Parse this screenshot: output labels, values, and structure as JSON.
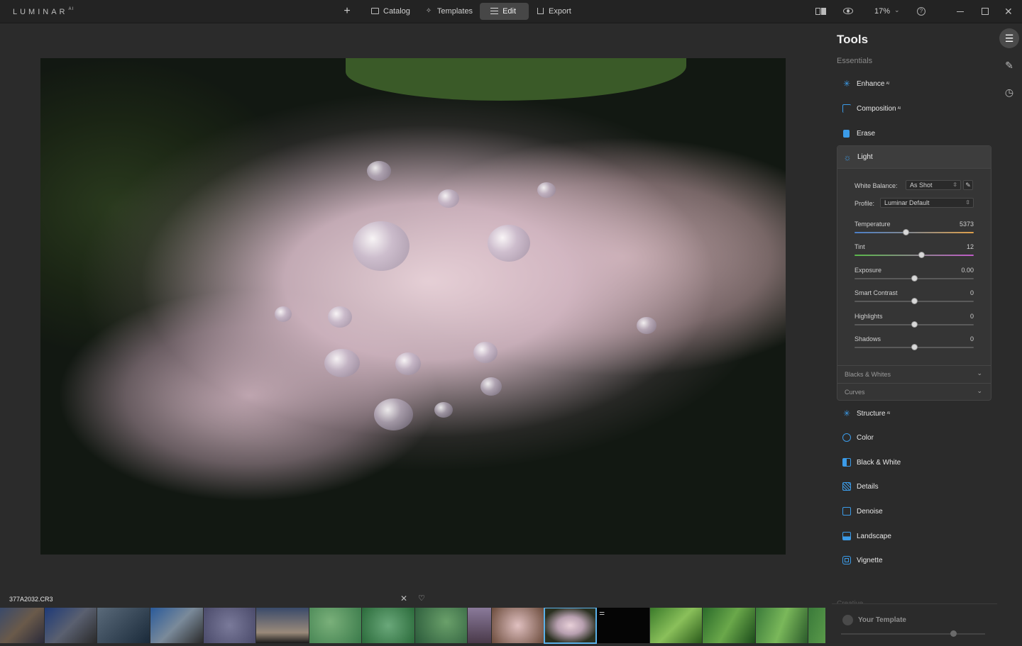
{
  "app": {
    "logo": "LUMINAR",
    "logo_sup": "AI"
  },
  "nav": {
    "add_label": "+",
    "items": [
      {
        "label": "Catalog",
        "icon": "folder-icon"
      },
      {
        "label": "Templates",
        "icon": "sparkle-icon"
      },
      {
        "label": "Edit",
        "icon": "sliders-icon",
        "active": true
      },
      {
        "label": "Export",
        "icon": "export-icon"
      }
    ]
  },
  "view": {
    "zoom": "17%",
    "help": "?"
  },
  "tools": {
    "title": "Tools",
    "section": "Essentials",
    "ai_badge": "AI",
    "items_top": [
      {
        "label": "Enhance",
        "ai": true,
        "icon": "enhance-icon"
      },
      {
        "label": "Composition",
        "ai": true,
        "icon": "crop-icon"
      },
      {
        "label": "Erase",
        "ai": false,
        "icon": "eraser-icon"
      }
    ],
    "light": {
      "label": "Light",
      "white_balance_label": "White Balance:",
      "white_balance_value": "As Shot",
      "profile_label": "Profile:",
      "profile_value": "Luminar Default",
      "sliders": [
        {
          "label": "Temperature",
          "value": "5373",
          "position": 0.43
        },
        {
          "label": "Tint",
          "value": "12",
          "position": 0.56
        },
        {
          "label": "Exposure",
          "value": "0.00",
          "position": 0.5
        },
        {
          "label": "Smart Contrast",
          "value": "0",
          "position": 0.5
        },
        {
          "label": "Highlights",
          "value": "0",
          "position": 0.5
        },
        {
          "label": "Shadows",
          "value": "0",
          "position": 0.5
        }
      ],
      "blacks_whites": "Blacks & Whites",
      "curves": "Curves"
    },
    "items_bottom": [
      {
        "label": "Structure",
        "ai": true,
        "icon": "structure-icon"
      },
      {
        "label": "Color",
        "ai": false,
        "icon": "color-icon"
      },
      {
        "label": "Black & White",
        "ai": false,
        "icon": "black-white-icon"
      },
      {
        "label": "Details",
        "ai": false,
        "icon": "details-icon"
      },
      {
        "label": "Denoise",
        "ai": false,
        "icon": "denoise-icon"
      },
      {
        "label": "Landscape",
        "ai": false,
        "icon": "landscape-icon"
      },
      {
        "label": "Vignette",
        "ai": false,
        "icon": "vignette-icon"
      }
    ],
    "creative_label": "Creative",
    "template_label": "Your Template",
    "template_amount": 0.78
  },
  "filmstrip": {
    "filename": "377A2032.CR3",
    "selected_index": 11
  },
  "colors": {
    "accent": "#3b9be8",
    "selection": "#5ab0e8"
  }
}
